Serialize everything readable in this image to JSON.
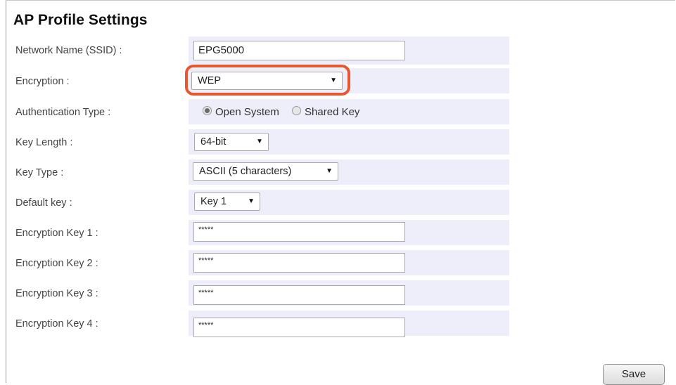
{
  "page": {
    "title": "AP Profile Settings"
  },
  "fields": {
    "ssid": {
      "label": "Network Name (SSID) :",
      "value": "EPG5000"
    },
    "encryption": {
      "label": "Encryption :",
      "value": "WEP"
    },
    "auth_type": {
      "label": "Authentication Type :",
      "options": [
        "Open System",
        "Shared Key"
      ],
      "selected": "Open System"
    },
    "key_length": {
      "label": "Key Length :",
      "value": "64-bit"
    },
    "key_type": {
      "label": "Key Type :",
      "value": "ASCII (5 characters)"
    },
    "default_key": {
      "label": "Default key :",
      "value": "Key 1"
    },
    "key1": {
      "label": "Encryption Key 1 :",
      "value": "*****"
    },
    "key2": {
      "label": "Encryption Key 2 :",
      "value": "*****"
    },
    "key3": {
      "label": "Encryption Key 3 :",
      "value": "*****"
    },
    "key4": {
      "label": "Encryption Key 4 :",
      "value": "*****"
    }
  },
  "actions": {
    "save_label": "Save"
  },
  "colors": {
    "highlight": "#e8572f",
    "row_background": "#eeeefa"
  },
  "icons": {
    "dropdown": "triangle-down-icon",
    "radio": "radio-icon"
  }
}
